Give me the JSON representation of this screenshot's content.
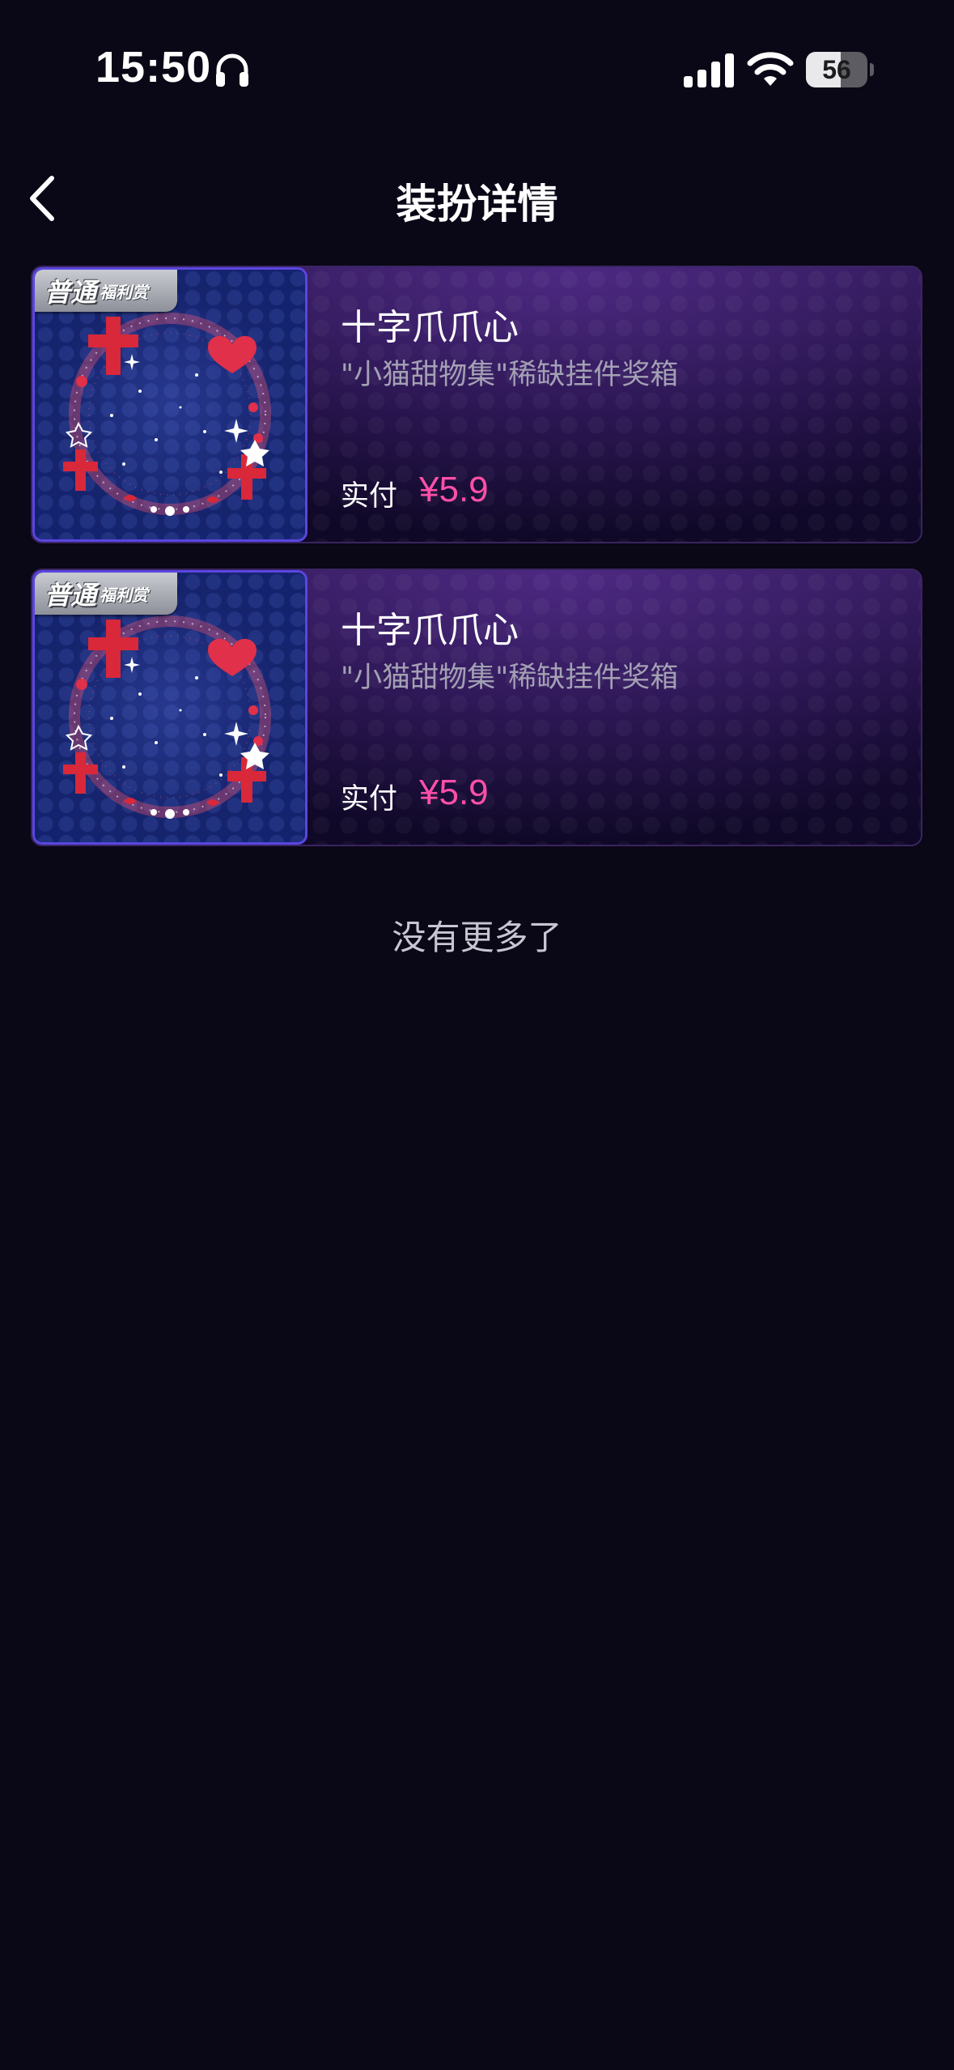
{
  "status_bar": {
    "time": "15:50",
    "battery_level": "56",
    "battery_fraction": 0.56,
    "icons": [
      "headphones-icon",
      "cellular-signal-icon",
      "wifi-icon",
      "battery-icon"
    ]
  },
  "header": {
    "back_icon": "chevron-left-icon",
    "title": "装扮详情"
  },
  "items": [
    {
      "tag_main": "普通",
      "tag_sub": "福利赏",
      "name": "十字爪爪心",
      "description": "\"小猫甜物集\"稀缺挂件奖箱",
      "pay_label": "实付",
      "price": "¥5.9"
    },
    {
      "tag_main": "普通",
      "tag_sub": "福利赏",
      "name": "十字爪爪心",
      "description": "\"小猫甜物集\"稀缺挂件奖箱",
      "pay_label": "实付",
      "price": "¥5.9"
    }
  ],
  "footer": {
    "no_more": "没有更多了"
  },
  "colors": {
    "background": "#0a0716",
    "price": "#ff4fa8",
    "card_border": "#3a2461",
    "thumb_border": "#5a46e0"
  }
}
